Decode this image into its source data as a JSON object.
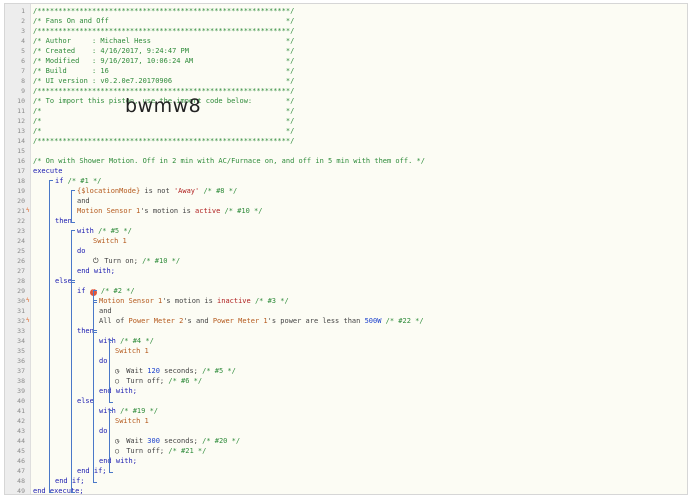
{
  "import_code": "bwmw8",
  "lines": [
    {
      "n": "1",
      "indent": 0,
      "parts": [
        {
          "t": "/************************************************************/",
          "c": "cm"
        }
      ]
    },
    {
      "n": "2",
      "indent": 0,
      "parts": [
        {
          "t": "/* Fans On and Off                                          */",
          "c": "cm"
        }
      ]
    },
    {
      "n": "3",
      "indent": 0,
      "parts": [
        {
          "t": "/************************************************************/",
          "c": "cm"
        }
      ]
    },
    {
      "n": "4",
      "indent": 0,
      "parts": [
        {
          "t": "/* Author     : Michael Hess                                */",
          "c": "cm"
        }
      ]
    },
    {
      "n": "5",
      "indent": 0,
      "parts": [
        {
          "t": "/* Created    : 4/16/2017, 9:24:47 PM                       */",
          "c": "cm"
        }
      ]
    },
    {
      "n": "6",
      "indent": 0,
      "parts": [
        {
          "t": "/* Modified   : 9/16/2017, 10:06:24 AM                      */",
          "c": "cm"
        }
      ]
    },
    {
      "n": "7",
      "indent": 0,
      "parts": [
        {
          "t": "/* Build      : 16                                          */",
          "c": "cm"
        }
      ]
    },
    {
      "n": "8",
      "indent": 0,
      "parts": [
        {
          "t": "/* UI version : v0.2.0e7.20170906                           */",
          "c": "cm"
        }
      ]
    },
    {
      "n": "9",
      "indent": 0,
      "parts": [
        {
          "t": "/************************************************************/",
          "c": "cm"
        }
      ]
    },
    {
      "n": "10",
      "indent": 0,
      "parts": [
        {
          "t": "/* To import this piston, use the import code below:        */",
          "c": "cm"
        }
      ]
    },
    {
      "n": "11",
      "indent": 0,
      "parts": [
        {
          "t": "/*                                                          */",
          "c": "cm"
        }
      ],
      "big": true
    },
    {
      "n": "12",
      "indent": 0,
      "parts": [
        {
          "t": "/*                                                          */",
          "c": "cm"
        }
      ]
    },
    {
      "n": "13",
      "indent": 0,
      "parts": [
        {
          "t": "/*                                                          */",
          "c": "cm"
        }
      ]
    },
    {
      "n": "14",
      "indent": 0,
      "parts": [
        {
          "t": "/************************************************************/",
          "c": "cm"
        }
      ]
    },
    {
      "n": "15",
      "indent": 0,
      "parts": []
    },
    {
      "n": "16",
      "indent": 0,
      "parts": [
        {
          "t": "/* On with Shower Motion. Off in 2 min with AC/Furnace on, and off in 5 min with them off. */",
          "c": "cm"
        }
      ]
    },
    {
      "n": "17",
      "indent": 0,
      "parts": [
        {
          "t": "execute",
          "c": "kw"
        }
      ]
    },
    {
      "n": "18",
      "indent": 22,
      "parts": [
        {
          "t": "if ",
          "c": "kw"
        },
        {
          "t": "/* #1 */",
          "c": "cm"
        }
      ]
    },
    {
      "n": "19",
      "indent": 44,
      "parts": [
        {
          "t": "{$locationMode}",
          "c": "dv"
        },
        {
          "t": " is not ",
          "c": "sub"
        },
        {
          "t": "'Away'",
          "c": "lit"
        },
        {
          "t": " /* #8 */",
          "c": "cm"
        }
      ]
    },
    {
      "n": "20",
      "indent": 44,
      "parts": [
        {
          "t": "and",
          "c": "sub"
        }
      ]
    },
    {
      "n": "21",
      "indent": 44,
      "mark": true,
      "parts": [
        {
          "t": "Motion Sensor 1",
          "c": "dv"
        },
        {
          "t": "'s motion is ",
          "c": "sub"
        },
        {
          "t": "active",
          "c": "lit"
        },
        {
          "t": " /* #10 */",
          "c": "cm"
        }
      ]
    },
    {
      "n": "22",
      "indent": 22,
      "parts": [
        {
          "t": "then",
          "c": "kw"
        }
      ]
    },
    {
      "n": "23",
      "indent": 44,
      "parts": [
        {
          "t": "with ",
          "c": "kw"
        },
        {
          "t": "/* #5 */",
          "c": "cm"
        }
      ]
    },
    {
      "n": "24",
      "indent": 60,
      "parts": [
        {
          "t": "Switch 1",
          "c": "dv"
        }
      ]
    },
    {
      "n": "25",
      "indent": 44,
      "parts": [
        {
          "t": "do",
          "c": "kw"
        }
      ]
    },
    {
      "n": "26",
      "indent": 60,
      "icon": "power",
      "parts": [
        {
          "t": "Turn on; ",
          "c": "sub"
        },
        {
          "t": "/* #10 */",
          "c": "cm"
        }
      ]
    },
    {
      "n": "27",
      "indent": 44,
      "parts": [
        {
          "t": "end with;",
          "c": "kw"
        }
      ]
    },
    {
      "n": "28",
      "indent": 22,
      "parts": [
        {
          "t": "else",
          "c": "kw"
        }
      ]
    },
    {
      "n": "29",
      "indent": 44,
      "icon": "warn",
      "parts": [
        {
          "t": "if ",
          "c": "kw"
        },
        {
          "t": " /* #2 */",
          "c": "cm"
        }
      ]
    },
    {
      "n": "30",
      "indent": 66,
      "mark": true,
      "parts": [
        {
          "t": "Motion Sensor 1",
          "c": "dv"
        },
        {
          "t": "'s motion is ",
          "c": "sub"
        },
        {
          "t": "inactive",
          "c": "lit"
        },
        {
          "t": " /* #3 */",
          "c": "cm"
        }
      ]
    },
    {
      "n": "31",
      "indent": 66,
      "parts": [
        {
          "t": "and",
          "c": "sub"
        }
      ]
    },
    {
      "n": "32",
      "indent": 66,
      "mark": true,
      "parts": [
        {
          "t": "All of ",
          "c": "sub"
        },
        {
          "t": "Power Meter 2",
          "c": "dv"
        },
        {
          "t": "'s and ",
          "c": "sub"
        },
        {
          "t": "Power Meter 1",
          "c": "dv"
        },
        {
          "t": "'s power are less than ",
          "c": "sub"
        },
        {
          "t": "500W",
          "c": "num"
        },
        {
          "t": " /* #22 */",
          "c": "cm"
        }
      ]
    },
    {
      "n": "33",
      "indent": 44,
      "parts": [
        {
          "t": "then",
          "c": "kw"
        }
      ]
    },
    {
      "n": "34",
      "indent": 66,
      "parts": [
        {
          "t": "with ",
          "c": "kw"
        },
        {
          "t": "/* #4 */",
          "c": "cm"
        }
      ]
    },
    {
      "n": "35",
      "indent": 82,
      "parts": [
        {
          "t": "Switch 1",
          "c": "dv"
        }
      ]
    },
    {
      "n": "36",
      "indent": 66,
      "parts": [
        {
          "t": "do",
          "c": "kw"
        }
      ]
    },
    {
      "n": "37",
      "indent": 82,
      "icon": "clock",
      "parts": [
        {
          "t": "Wait ",
          "c": "sub"
        },
        {
          "t": "120",
          "c": "num"
        },
        {
          "t": " seconds; ",
          "c": "sub"
        },
        {
          "t": "/* #5 */",
          "c": "cm"
        }
      ]
    },
    {
      "n": "38",
      "indent": 82,
      "icon": "circle",
      "parts": [
        {
          "t": "Turn off; ",
          "c": "sub"
        },
        {
          "t": "/* #6 */",
          "c": "cm"
        }
      ]
    },
    {
      "n": "39",
      "indent": 66,
      "parts": [
        {
          "t": "end with;",
          "c": "kw"
        }
      ]
    },
    {
      "n": "40",
      "indent": 44,
      "parts": [
        {
          "t": "else",
          "c": "kw"
        }
      ]
    },
    {
      "n": "41",
      "indent": 66,
      "parts": [
        {
          "t": "with ",
          "c": "kw"
        },
        {
          "t": "/* #19 */",
          "c": "cm"
        }
      ]
    },
    {
      "n": "42",
      "indent": 82,
      "parts": [
        {
          "t": "Switch 1",
          "c": "dv"
        }
      ]
    },
    {
      "n": "43",
      "indent": 66,
      "parts": [
        {
          "t": "do",
          "c": "kw"
        }
      ]
    },
    {
      "n": "44",
      "indent": 82,
      "icon": "clock",
      "parts": [
        {
          "t": "Wait ",
          "c": "sub"
        },
        {
          "t": "300",
          "c": "num"
        },
        {
          "t": " seconds; ",
          "c": "sub"
        },
        {
          "t": "/* #20 */",
          "c": "cm"
        }
      ]
    },
    {
      "n": "45",
      "indent": 82,
      "icon": "circle",
      "parts": [
        {
          "t": "Turn off; ",
          "c": "sub"
        },
        {
          "t": "/* #21 */",
          "c": "cm"
        }
      ]
    },
    {
      "n": "46",
      "indent": 66,
      "parts": [
        {
          "t": "end with;",
          "c": "kw"
        }
      ]
    },
    {
      "n": "47",
      "indent": 44,
      "parts": [
        {
          "t": "end if;",
          "c": "kw"
        }
      ]
    },
    {
      "n": "48",
      "indent": 22,
      "parts": [
        {
          "t": "end if;",
          "c": "kw"
        }
      ]
    },
    {
      "n": "49",
      "indent": 0,
      "parts": [
        {
          "t": "end execute;",
          "c": "kw"
        }
      ]
    }
  ]
}
